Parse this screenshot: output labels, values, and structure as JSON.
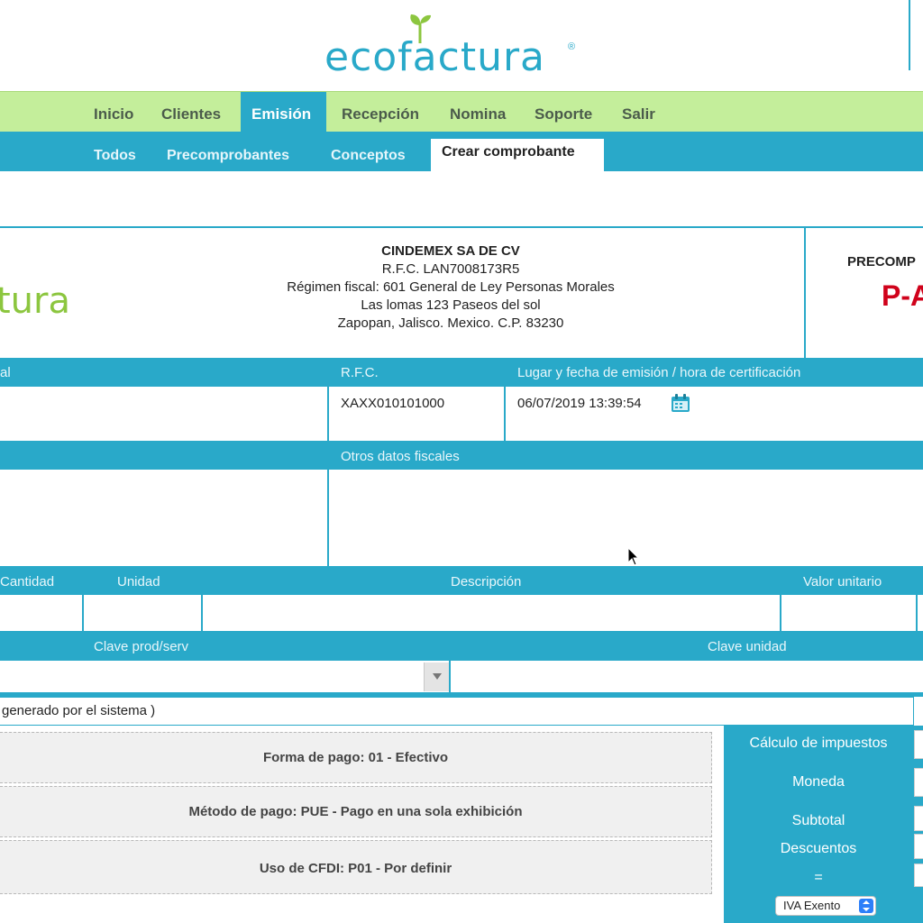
{
  "brand": {
    "logo_text": "ecofactura",
    "accent": "#29a9c9",
    "nav_green": "#c4ee9b"
  },
  "nav_main": [
    "Inicio",
    "Clientes",
    "Emisión",
    "Recepción",
    "Nomina",
    "Soporte",
    "Salir"
  ],
  "nav_main_active": "Emisión",
  "nav_sub": [
    "Todos",
    "Precomprobantes",
    "Conceptos",
    "Crear comprobante"
  ],
  "nav_sub_active": "Crear comprobante",
  "issuer": {
    "logo_partial": "tura",
    "name": "CINDEMEX SA DE CV",
    "rfc": "R.F.C. LAN7008173R5",
    "regimen": "Régimen fiscal: 601 General de Ley Personas Morales",
    "address1": "Las lomas 123 Paseos del sol",
    "address2": "Zapopan, Jalisco. Mexico. C.P. 83230"
  },
  "precomprobante": {
    "label": "PRECOMP",
    "number": "P-A"
  },
  "receptor": {
    "col1_header": "al",
    "rfc_header": "R.F.C.",
    "rfc_value": "XAXX010101000",
    "fecha_header": "Lugar y fecha de emisión / hora de certificación",
    "fecha_value": "06/07/2019 13:39:54",
    "otros_header": "Otros datos fiscales"
  },
  "concepts": {
    "headers": [
      "Cantidad",
      "Unidad",
      "Descripción",
      "Valor unitario"
    ],
    "clave_prod": "Clave prod/serv",
    "clave_unidad": "Clave unidad"
  },
  "folio_text": "generado por el sistema )",
  "payment": {
    "forma": "Forma de pago: 01 - Efectivo",
    "metodo": "Método de pago: PUE - Pago en una sola exhibición",
    "uso": "Uso de CFDI: P01 - Por definir"
  },
  "side": {
    "calculo": "Cálculo de impuestos",
    "moneda": "Moneda",
    "subtotal": "Subtotal",
    "descuentos": "Descuentos",
    "equals": "=",
    "iva_option": "IVA Exento"
  }
}
